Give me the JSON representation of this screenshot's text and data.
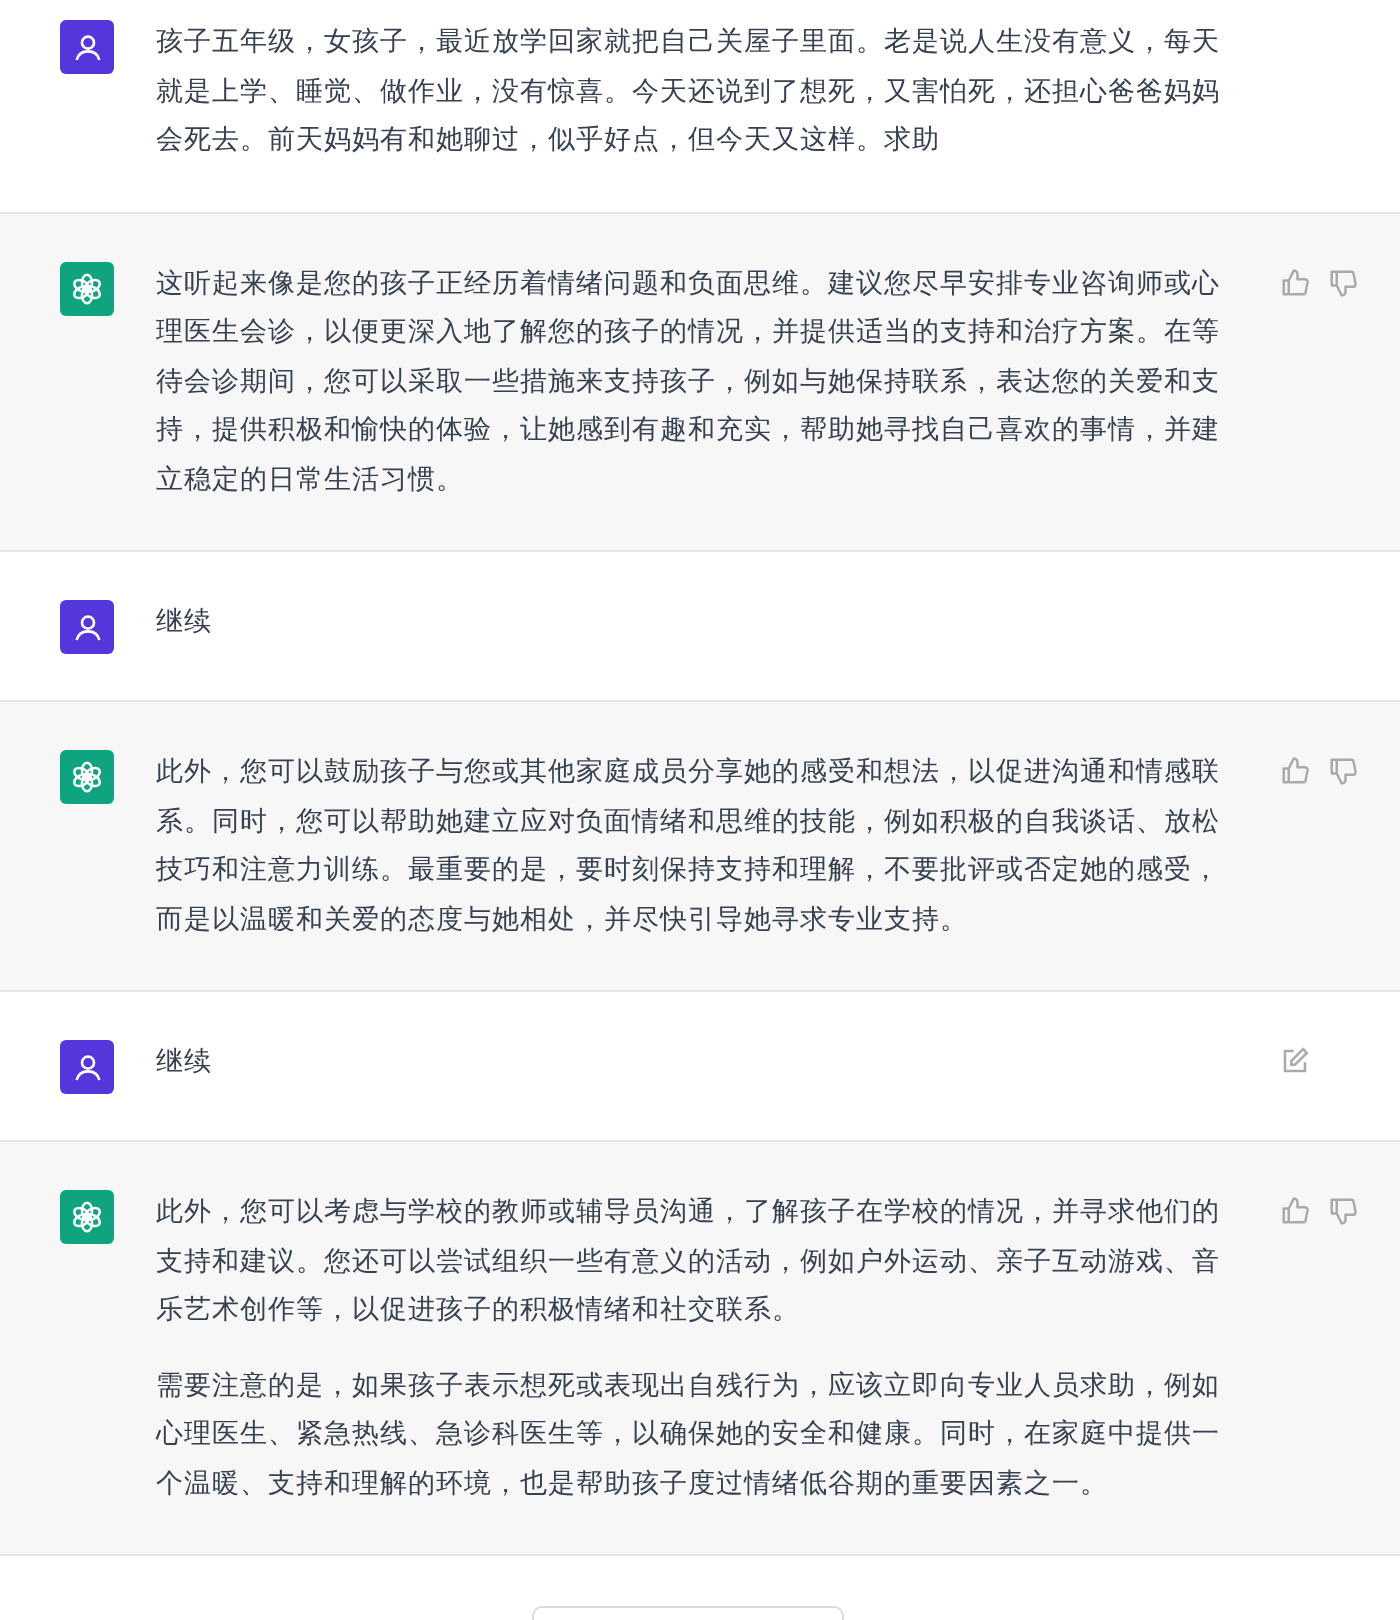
{
  "messages": [
    {
      "kind": "user",
      "hovered": false,
      "paragraphs": [
        "孩子五年级，女孩子，最近放学回家就把自己关屋子里面。老是说人生没有意义，每天就是上学、睡觉、做作业，没有惊喜。今天还说到了想死，又害怕死，还担心爸爸妈妈会死去。前天妈妈有和她聊过，似乎好点，但今天又这样。求助"
      ]
    },
    {
      "kind": "assistant",
      "paragraphs": [
        "这听起来像是您的孩子正经历着情绪问题和负面思维。建议您尽早安排专业咨询师或心理医生会诊，以便更深入地了解您的孩子的情况，并提供适当的支持和治疗方案。在等待会诊期间，您可以采取一些措施来支持孩子，例如与她保持联系，表达您的关爱和支持，提供积极和愉快的体验，让她感到有趣和充实，帮助她寻找自己喜欢的事情，并建立稳定的日常生活习惯。"
      ]
    },
    {
      "kind": "user",
      "hovered": false,
      "paragraphs": [
        "继续"
      ]
    },
    {
      "kind": "assistant",
      "paragraphs": [
        "此外，您可以鼓励孩子与您或其他家庭成员分享她的感受和想法，以促进沟通和情感联系。同时，您可以帮助她建立应对负面情绪和思维的技能，例如积极的自我谈话、放松技巧和注意力训练。最重要的是，要时刻保持支持和理解，不要批评或否定她的感受，而是以温暖和关爱的态度与她相处，并尽快引导她寻求专业支持。"
      ]
    },
    {
      "kind": "user",
      "hovered": true,
      "paragraphs": [
        "继续"
      ]
    },
    {
      "kind": "assistant",
      "paragraphs": [
        "此外，您可以考虑与学校的教师或辅导员沟通，了解孩子在学校的情况，并寻求他们的支持和建议。您还可以尝试组织一些有意义的活动，例如户外运动、亲子互动游戏、音乐艺术创作等，以促进孩子的积极情绪和社交联系。",
        "需要注意的是，如果孩子表示想死或表现出自残行为，应该立即向专业人员求助，例如心理医生、紧急热线、急诊科医生等，以确保她的安全和健康。同时，在家庭中提供一个温暖、支持和理解的环境，也是帮助孩子度过情绪低谷期的重要因素之一。"
      ]
    }
  ]
}
